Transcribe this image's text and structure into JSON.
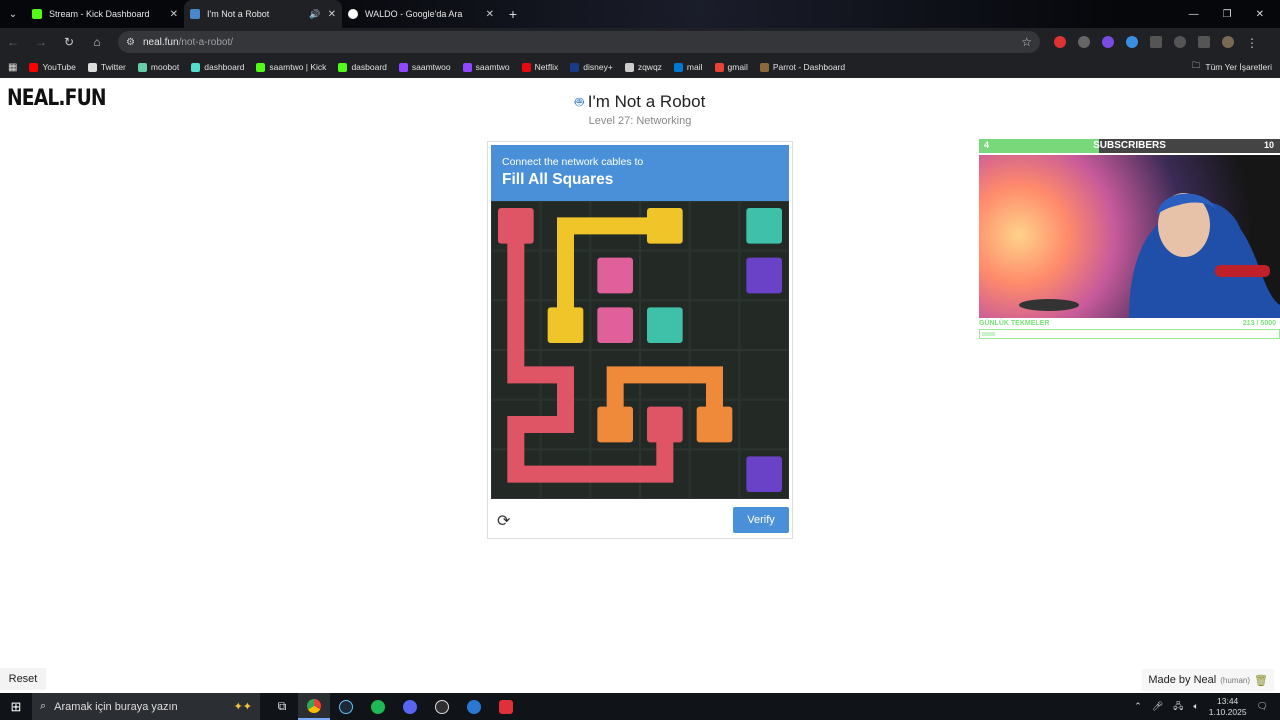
{
  "browser": {
    "tabs": [
      {
        "title": "Stream - Kick Dashboard",
        "favicon_color": "#53fc18",
        "active": false,
        "muted_icon": false
      },
      {
        "title": "I'm Not a Robot",
        "favicon_color": "#4a86c8",
        "active": true,
        "muted_icon": true
      },
      {
        "title": "WALDO - Google'da Ara",
        "favicon_color": "#ffffff",
        "active": false,
        "muted_icon": false
      }
    ],
    "address": {
      "host": "neal.fun",
      "path": "/not-a-robot/"
    },
    "bookmarks": [
      {
        "label": "YouTube",
        "color": "#ff0000"
      },
      {
        "label": "Twitter",
        "color": "#dddddd"
      },
      {
        "label": "moobot",
        "color": "#66ccaa"
      },
      {
        "label": "dashboard",
        "color": "#55ddcc"
      },
      {
        "label": "saamtwo | Kick",
        "color": "#53fc18"
      },
      {
        "label": "dasboard",
        "color": "#53fc18"
      },
      {
        "label": "saamtwoo",
        "color": "#9146ff"
      },
      {
        "label": "saamtwo",
        "color": "#9146ff"
      },
      {
        "label": "Netflix",
        "color": "#e50914"
      },
      {
        "label": "disney+",
        "color": "#1a3a8a"
      },
      {
        "label": "zqwqz",
        "color": "#cccccc"
      },
      {
        "label": "mail",
        "color": "#0078d4"
      },
      {
        "label": "gmail",
        "color": "#ea4335"
      },
      {
        "label": "Parrot - Dashboard",
        "color": "#8a6a3a"
      }
    ],
    "bookmarks_right": "Tüm Yer İşaretleri"
  },
  "page": {
    "logo": "NEAL.FUN",
    "title": "I'm Not a Robot",
    "level": "Level 27: Networking",
    "captcha": {
      "instruction_small": "Connect the network cables to",
      "instruction_big": "Fill All Squares",
      "verify_label": "Verify",
      "grid_size": 6,
      "colors": {
        "red": "#e05566",
        "yellow": "#f0c52a",
        "pink": "#e0609a",
        "teal": "#3fc0a8",
        "purple": "#6a42c8",
        "orange": "#ef8a3a"
      },
      "nodes": [
        {
          "color": "red",
          "col": 0,
          "row": 0
        },
        {
          "color": "yellow",
          "col": 3,
          "row": 0
        },
        {
          "color": "teal",
          "col": 5,
          "row": 0
        },
        {
          "color": "pink",
          "col": 2,
          "row": 1
        },
        {
          "color": "purple",
          "col": 5,
          "row": 1
        },
        {
          "color": "yellow",
          "col": 1,
          "row": 2
        },
        {
          "color": "pink",
          "col": 2,
          "row": 2
        },
        {
          "color": "teal",
          "col": 3,
          "row": 2
        },
        {
          "color": "orange",
          "col": 2,
          "row": 4
        },
        {
          "color": "red",
          "col": 3,
          "row": 4
        },
        {
          "color": "orange",
          "col": 4,
          "row": 4
        },
        {
          "color": "purple",
          "col": 5,
          "row": 5
        }
      ],
      "cables": [
        {
          "color": "yellow",
          "cells": [
            [
              3,
              0
            ],
            [
              2,
              0
            ],
            [
              1,
              0
            ],
            [
              1,
              1
            ],
            [
              1,
              2
            ]
          ]
        },
        {
          "color": "red",
          "cells": [
            [
              0,
              0
            ],
            [
              0,
              1
            ],
            [
              0,
              2
            ],
            [
              0,
              3
            ],
            [
              1,
              3
            ],
            [
              1,
              4
            ],
            [
              0,
              4
            ],
            [
              0,
              5
            ],
            [
              1,
              5
            ],
            [
              2,
              5
            ],
            [
              3,
              5
            ],
            [
              3,
              4
            ]
          ]
        },
        {
          "color": "orange",
          "cells": [
            [
              2,
              4
            ],
            [
              2,
              3
            ],
            [
              3,
              3
            ],
            [
              4,
              3
            ],
            [
              4,
              4
            ]
          ]
        }
      ]
    }
  },
  "stream_overlay": {
    "sub_left": "4",
    "sub_label": "SUBSCRIBERS",
    "sub_right": "10",
    "sub_progress": 0.4,
    "goal_label": "GÜNLÜK TEKMELER",
    "goal_value": "213 / 5000",
    "goal_progress": 0.043
  },
  "footer": {
    "reset_label": "Reset",
    "made_by": "Made by Neal",
    "human": "(human)"
  },
  "taskbar": {
    "search_placeholder": "Aramak için buraya yazın",
    "time": "13:44",
    "date": "1.10.2025"
  }
}
